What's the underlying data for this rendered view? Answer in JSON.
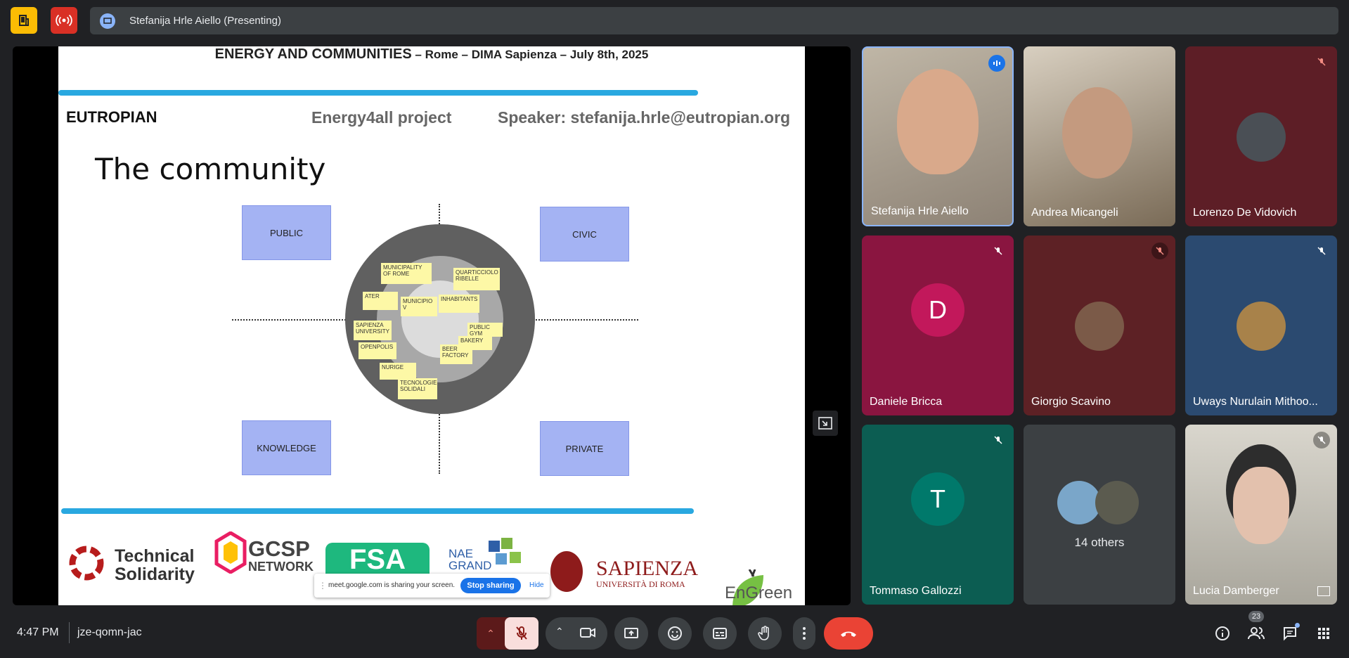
{
  "top_bar": {
    "presenting_label": "Stefanija Hrle Aiello (Presenting)"
  },
  "slide": {
    "header_bold": "ENERGY AND COMMUNITIES",
    "header_rest": " – Rome – DIMA Sapienza – July 8th, 2025",
    "org": "EUTROPIAN",
    "project": "Energy4all project",
    "speaker": "Speaker: stefanija.hrle@eutropian.org",
    "title": "The community",
    "quadrants": [
      "PUBLIC",
      "CIVIC",
      "KNOWLEDGE",
      "PRIVATE"
    ],
    "notes": [
      "MUNICIPALITY OF ROME",
      "QUARTICCIOLO RIBELLE",
      "ATER",
      "MUNICIPIO V",
      "INHABITANTS",
      "SAPIENZA UNIVERSITY",
      "PUBLIC GYM",
      "OPENPOLIS",
      "BAKERY",
      "BEER FACTORY",
      "NURIGE",
      "TECNOLOGIE SOLIDALI"
    ],
    "logos": {
      "ts_line1": "Technical",
      "ts_line2": "Solidarity",
      "gcsp_line1": "GCSP",
      "gcsp_line2": "NETWORK",
      "fsa": "FSA",
      "nae_line1": "NAE",
      "nae_line2": "GRAND",
      "sapienza": "SAPIENZA",
      "sapienza_sub": "UNIVERSITÀ DI ROMA",
      "engreen": "EnGreen"
    }
  },
  "share_notice": {
    "text": "meet.google.com is sharing your screen.",
    "stop": "Stop sharing",
    "hide": "Hide"
  },
  "participants": [
    {
      "name": "Stefanija Hrle Aiello",
      "muted": false,
      "speaking": true
    },
    {
      "name": "Andrea Micangeli",
      "muted": false
    },
    {
      "name": "Lorenzo De Vidovich",
      "muted": true
    },
    {
      "name": "Daniele Bricca",
      "muted": true,
      "initial": "D",
      "color": "#c2185b"
    },
    {
      "name": "Giorgio Scavino",
      "muted": true
    },
    {
      "name": "Uways Nurulain Mithoo...",
      "muted": true
    },
    {
      "name": "Tommaso Gallozzi",
      "muted": true,
      "initial": "T",
      "color": "#00796b"
    },
    {
      "name": "Lucia Damberger",
      "muted": true
    }
  ],
  "others_label": "14 others",
  "bottom_bar": {
    "time": "4:47 PM",
    "meeting_code": "jze-qomn-jac",
    "people_count": "23"
  },
  "colors": {
    "leave_red": "#ea4335",
    "mic_off_red": "#f28b82",
    "accent_blue": "#8ab4f8"
  }
}
